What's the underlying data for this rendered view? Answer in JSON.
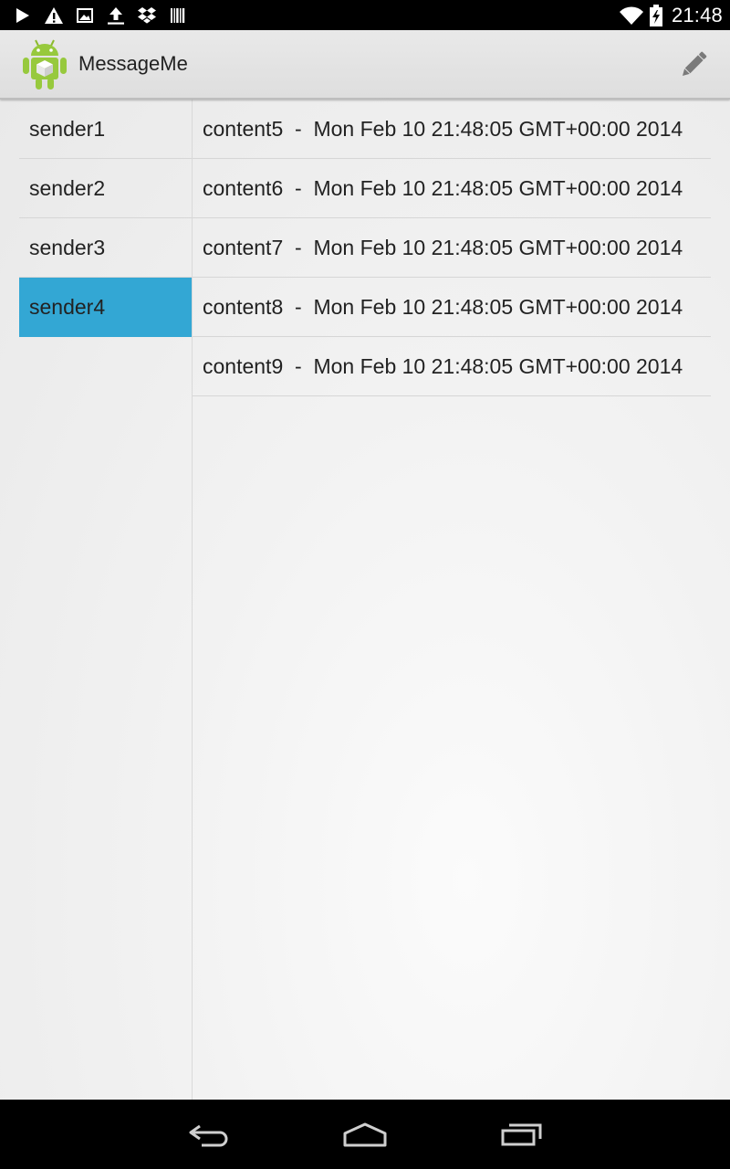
{
  "status_bar": {
    "time": "21:48",
    "left_icons": [
      "play-icon",
      "warning-icon",
      "image-icon",
      "upload-icon",
      "dropbox-icon",
      "barcode-icon"
    ],
    "right_icons": [
      "wifi-icon",
      "battery-charging-icon"
    ]
  },
  "action_bar": {
    "title": "MessageMe",
    "logo_icon": "android-app-icon",
    "compose_icon": "pencil-icon"
  },
  "senders": [
    {
      "label": "sender1",
      "selected": false
    },
    {
      "label": "sender2",
      "selected": false
    },
    {
      "label": "sender3",
      "selected": false
    },
    {
      "label": "sender4",
      "selected": true
    }
  ],
  "messages": [
    {
      "content": "content5",
      "separator": "  -  ",
      "timestamp": "Mon Feb 10 21:48:05 GMT+00:00 2014"
    },
    {
      "content": "content6",
      "separator": "  -  ",
      "timestamp": "Mon Feb 10 21:48:05 GMT+00:00 2014"
    },
    {
      "content": "content7",
      "separator": "  -  ",
      "timestamp": "Mon Feb 10 21:48:05 GMT+00:00 2014"
    },
    {
      "content": "content8",
      "separator": "  -  ",
      "timestamp": "Mon Feb 10 21:48:05 GMT+00:00 2014"
    },
    {
      "content": "content9",
      "separator": "  -  ",
      "timestamp": "Mon Feb 10 21:48:05 GMT+00:00 2014"
    }
  ],
  "nav_bar": {
    "buttons": [
      "back-icon",
      "home-icon",
      "recent-apps-icon"
    ]
  },
  "colors": {
    "selection": "#33a7d4",
    "action_bar": "#e4e4e4",
    "text": "#222222"
  }
}
